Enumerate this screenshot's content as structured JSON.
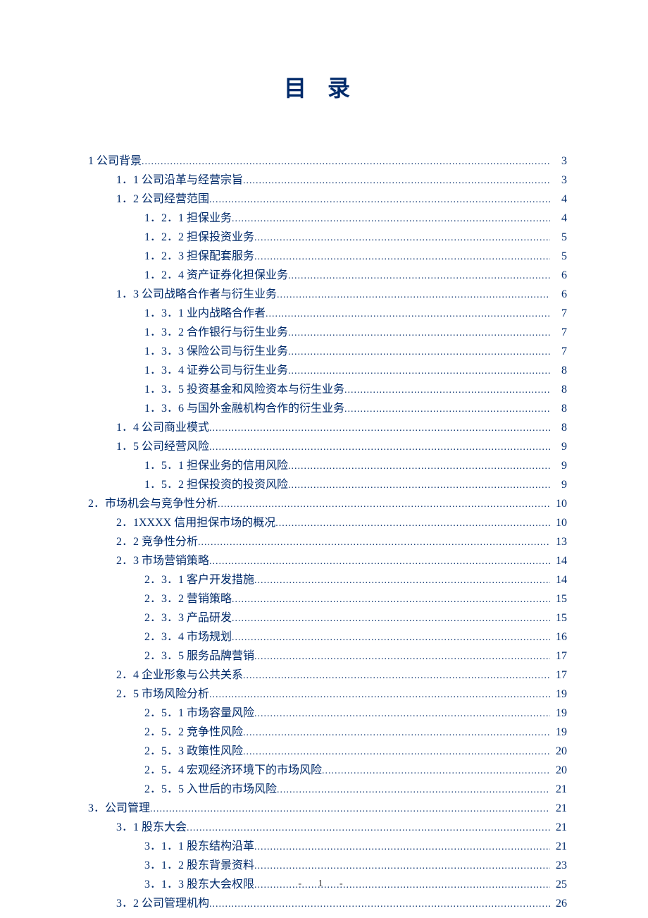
{
  "title": "目录",
  "footer": "- 1 -",
  "toc": [
    {
      "level": 0,
      "label": "1 公司背景",
      "page": "3"
    },
    {
      "level": 1,
      "label": "1．1 公司沿革与经营宗旨",
      "page": "3"
    },
    {
      "level": 1,
      "label": "1．2 公司经营范围",
      "page": "4"
    },
    {
      "level": 2,
      "label": "1．2．1 担保业务",
      "page": "4"
    },
    {
      "level": 2,
      "label": "1．2．2 担保投资业务",
      "page": "5"
    },
    {
      "level": 2,
      "label": "1．2．3 担保配套服务",
      "page": "5"
    },
    {
      "level": 2,
      "label": "1．2．4 资产证券化担保业务",
      "page": "6"
    },
    {
      "level": 1,
      "label": "1．3 公司战略合作者与衍生业务",
      "page": "6"
    },
    {
      "level": 2,
      "label": "1．3．1 业内战略合作者",
      "page": "7"
    },
    {
      "level": 2,
      "label": "1．3．2 合作银行与衍生业务",
      "page": "7"
    },
    {
      "level": 2,
      "label": "1．3．3 保险公司与衍生业务",
      "page": "7"
    },
    {
      "level": 2,
      "label": "1．3．4 证券公司与衍生业务",
      "page": "8"
    },
    {
      "level": 2,
      "label": "1．3．5 投资基金和风险资本与衍生业务",
      "page": "8"
    },
    {
      "level": 2,
      "label": "1．3．6 与国外金融机构合作的衍生业务",
      "page": "8"
    },
    {
      "level": 1,
      "label": "1．4 公司商业模式",
      "page": "8"
    },
    {
      "level": 1,
      "label": "1．5 公司经营风险",
      "page": "9"
    },
    {
      "level": 2,
      "label": "1．5．1 担保业务的信用风险",
      "page": "9"
    },
    {
      "level": 2,
      "label": "1．5．2 担保投资的投资风险",
      "page": "9"
    },
    {
      "level": 0,
      "label": "2．市场机会与竞争性分析",
      "page": "10"
    },
    {
      "level": 1,
      "label": "2．1XXXX 信用担保市场的概况",
      "page": "10"
    },
    {
      "level": 1,
      "label": "2．2 竞争性分析",
      "page": "13"
    },
    {
      "level": 1,
      "label": "2．3 市场营销策略",
      "page": "14"
    },
    {
      "level": 2,
      "label": "2．3．1 客户开发措施",
      "page": "14"
    },
    {
      "level": 2,
      "label": "2．3．2 营销策略",
      "page": "15"
    },
    {
      "level": 2,
      "label": "2．3．3 产品研发",
      "page": "15"
    },
    {
      "level": 2,
      "label": "2．3．4 市场规划",
      "page": "16"
    },
    {
      "level": 2,
      "label": "2．3．5 服务品牌营销",
      "page": "17"
    },
    {
      "level": 1,
      "label": "2．4 企业形象与公共关系",
      "page": "17"
    },
    {
      "level": 1,
      "label": "2．5 市场风险分析",
      "page": "19"
    },
    {
      "level": 2,
      "label": "2．5．1 市场容量风险",
      "page": "19"
    },
    {
      "level": 2,
      "label": "2．5．2 竞争性风险",
      "page": "19"
    },
    {
      "level": 2,
      "label": "2．5．3 政策性风险",
      "page": "20"
    },
    {
      "level": 2,
      "label": "2．5．4 宏观经济环境下的市场风险",
      "page": "20"
    },
    {
      "level": 2,
      "label": "2．5．5 入世后的市场风险",
      "page": "21"
    },
    {
      "level": 0,
      "label": "3．公司管理",
      "page": "21"
    },
    {
      "level": 1,
      "label": "3．1 股东大会",
      "page": "21"
    },
    {
      "level": 2,
      "label": "3．1．1 股东结构沿革",
      "page": "21"
    },
    {
      "level": 2,
      "label": "3．1．2 股东背景资料",
      "page": "23"
    },
    {
      "level": 2,
      "label": "3．1．3 股东大会权限",
      "page": "25"
    },
    {
      "level": 1,
      "label": "3．2 公司管理机构",
      "page": "26"
    }
  ]
}
